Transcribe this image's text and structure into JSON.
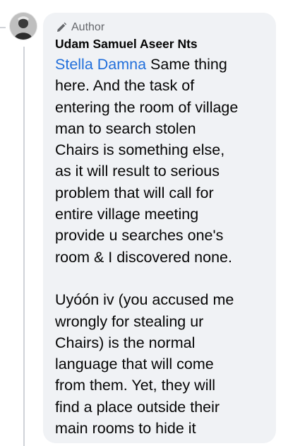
{
  "comment": {
    "badge_label": "Author",
    "author_name": "Udam Samuel Aseer Nts",
    "mention": "Stella Damna",
    "first_line_rest": " Same thing",
    "paragraph_1_lines": [
      "here. And the task of",
      "entering the room of village",
      "man to search stolen",
      "Chairs is something else,",
      "as it will result to serious",
      "problem that will call for",
      "entire village meeting",
      "provide u searches one's",
      "room & I discovered none."
    ],
    "paragraph_2_lines": [
      "Uyóón iv (you accused me",
      "wrongly for stealing ur",
      "Chairs) is the normal",
      "language that will come",
      "from them. Yet, they will",
      "find a place outside their",
      "main rooms to hide it"
    ]
  },
  "colors": {
    "bubble_background": "#f0f2f5",
    "mention_link": "#216fdb",
    "badge_text": "#65676b",
    "body_text": "#050505",
    "thread_line": "#d0d3d8"
  },
  "icons": {
    "badge": "pencil-icon",
    "avatar": "user-avatar"
  }
}
